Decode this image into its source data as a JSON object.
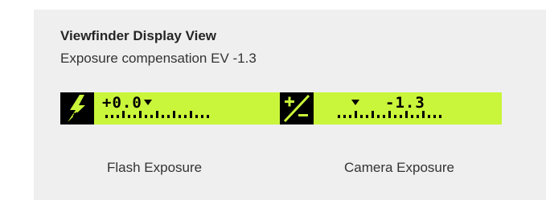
{
  "header": {
    "title": "Viewfinder Display View",
    "subtitle": "Exposure compensation EV -1.3"
  },
  "display": {
    "flash": {
      "icon": "flash-compensation-icon",
      "value": "+0.0",
      "caption": "Flash Exposure"
    },
    "camera": {
      "icon": "exposure-compensation-icon",
      "value": "-1.3",
      "caption": "Camera Exposure"
    }
  },
  "colors": {
    "lcd_background": "#c9f53a",
    "lcd_foreground": "#000000",
    "panel_background": "#efefef"
  }
}
